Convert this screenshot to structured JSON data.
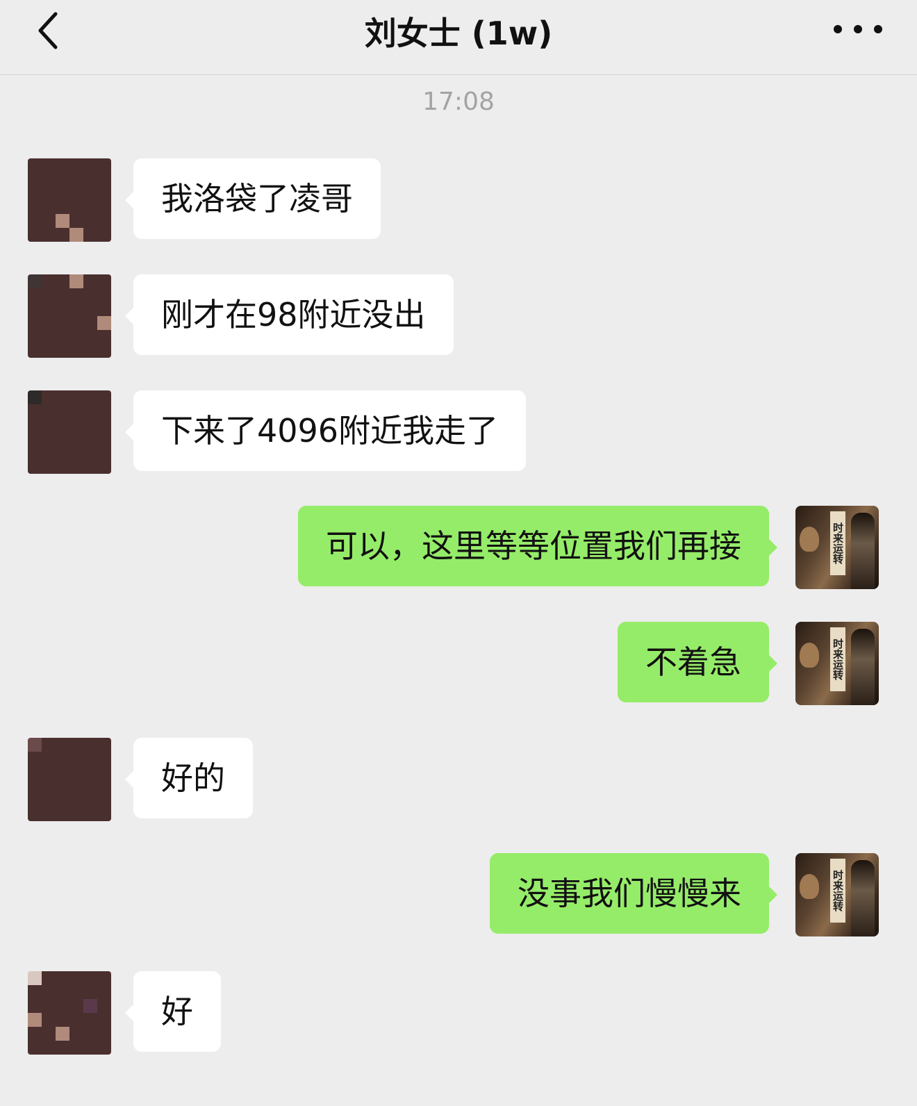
{
  "header": {
    "title": "刘女士 (1w)",
    "back_icon": "chevron-left-icon",
    "more_icon": "more-dots-icon"
  },
  "timestamp": "17:08",
  "messages": [
    {
      "side": "left",
      "text": "我洛袋了凌哥"
    },
    {
      "side": "left",
      "text": "刚才在98附近没出"
    },
    {
      "side": "left",
      "text": "下来了4096附近我走了"
    },
    {
      "side": "right",
      "text": "可以，这里等等位置我们再接"
    },
    {
      "side": "right",
      "text": "不着急"
    },
    {
      "side": "left",
      "text": "好的"
    },
    {
      "side": "right",
      "text": "没事我们慢慢来"
    },
    {
      "side": "left",
      "text": "好"
    }
  ],
  "my_avatar_text": "时来运转",
  "colors": {
    "background": "#ededed",
    "incoming_bubble": "#ffffff",
    "outgoing_bubble": "#95ec69"
  }
}
